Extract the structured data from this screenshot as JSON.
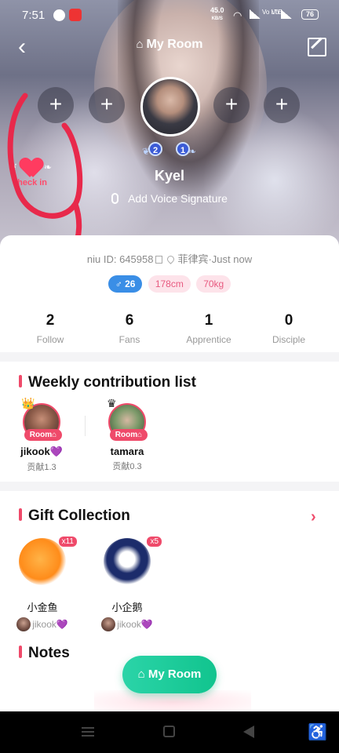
{
  "status_bar": {
    "time": "7:51",
    "network_speed": "45.0",
    "network_unit": "KB/S",
    "sim1_tag": "Vo LTE",
    "sim2_tag": "Vo",
    "battery": "76"
  },
  "header": {
    "title": "My Room"
  },
  "profile": {
    "checkin_label": "check in",
    "name": "Kyel",
    "voice_signature": "Add Voice Signature",
    "level_badges": [
      "2",
      "1"
    ],
    "id_text": "niu ID: 645958",
    "location_text": "菲律宾·Just now",
    "gender_age": "♂ 26",
    "height": "178cm",
    "weight": "70kg"
  },
  "stats": [
    {
      "value": "2",
      "label": "Follow"
    },
    {
      "value": "6",
      "label": "Fans"
    },
    {
      "value": "1",
      "label": "Apprentice"
    },
    {
      "value": "0",
      "label": "Disciple"
    }
  ],
  "weekly": {
    "title": "Weekly contribution list",
    "items": [
      {
        "name": "jikook💜",
        "sub": "贡献1.3",
        "badge": "Room"
      },
      {
        "name": "tamara",
        "sub": "贡献0.3",
        "badge": "Room"
      }
    ]
  },
  "gifts": {
    "title": "Gift Collection",
    "items": [
      {
        "name": "小金鱼",
        "count": "x11",
        "from": "jikook💜"
      },
      {
        "name": "小企鹅",
        "count": "x5",
        "from": "jikook💜"
      }
    ]
  },
  "notes": {
    "title": "Notes"
  },
  "fab": {
    "label": "My Room"
  },
  "colors": {
    "accent": "#ef4a6a",
    "fab": "#11c48e",
    "gender_tag": "#3a8ee6"
  }
}
